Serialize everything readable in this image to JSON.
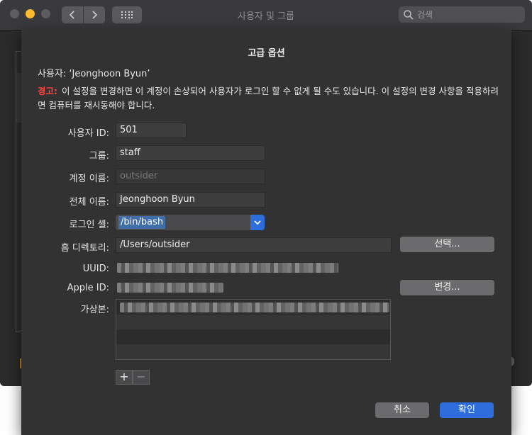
{
  "window": {
    "title": "사용자 및 그룹",
    "search_placeholder": "검색"
  },
  "sheet": {
    "title": "고급 옵션",
    "user_line": "사용자:  ‘Jeonghoon Byun’",
    "warning_label": "경고:",
    "warning_text": "이 설정을 변경하면 이 계정이 손상되어 사용자가 로그인 할 수 없게 될 수도 있습니다. 이 설정의 변경 사항을 적용하려면 컴퓨터를 재시동해야 합니다.",
    "fields": {
      "uid_label": "사용자 ID:",
      "uid_value": "501",
      "group_label": "그룹:",
      "group_value": "staff",
      "account_label": "계정 이름:",
      "account_value": "outsider",
      "fullname_label": "전체 이름:",
      "fullname_value": "Jeonghoon Byun",
      "shell_label": "로그인 셸:",
      "shell_value": "/bin/bash",
      "home_label": "홈 디렉토리:",
      "home_value": "/Users/outsider",
      "uuid_label": "UUID:",
      "appleid_label": "Apple ID:",
      "alias_label": "가상본:"
    },
    "buttons": {
      "choose": "선택...",
      "change": "변경...",
      "add": "+",
      "remove": "−",
      "cancel": "취소",
      "ok": "확인"
    }
  }
}
